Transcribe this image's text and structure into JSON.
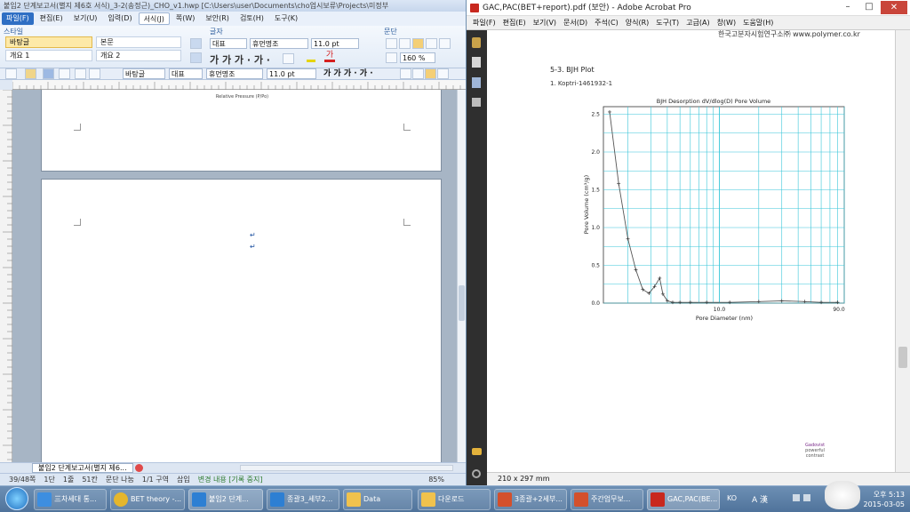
{
  "hwp": {
    "title": "붙임2 단계보고서(별지 제6호 서식)_3-2(송정근)_CHO_v1.hwp [C:\\Users\\user\\Documents\\cho업시보류\\Projects\\미정부",
    "menu": [
      "파일(F)",
      "편집(E)",
      "보기(U)",
      "입력(D)",
      "서식(J)",
      "쪽(W)",
      "보안(R)",
      "검토(H)",
      "도구(K)"
    ],
    "style_group": "스타일",
    "styles": [
      "바탕글",
      "본문",
      "개요 1",
      "개요 2"
    ],
    "font_group": "글자",
    "para_group": "문단",
    "font_lang": "대표",
    "font_name": "휴먼명조",
    "font_size": "11.0",
    "font_unit": "pt",
    "line_spacing": "160 %",
    "toolbar2": {
      "style": "바탕글",
      "lang": "대표",
      "font": "휴먼명조",
      "size": "11.0",
      "unit": "pt"
    },
    "page1_footer": "Relative Pressure (P/Po)",
    "tab_label": "붙임2 단계보고서(별지 제6...",
    "status": [
      "39/48쪽",
      "1단",
      "1줄",
      "51칸",
      "문단 나눔",
      "1/1 구역",
      "삽입",
      "변경 내용 [기록 중지]"
    ],
    "zoom": "85%"
  },
  "acrobat": {
    "title": "GAC,PAC(BET+report).pdf (보안) - Adobe Acrobat Pro",
    "menu": [
      "파일(F)",
      "편집(E)",
      "보기(V)",
      "문서(D)",
      "주석(C)",
      "양식(R)",
      "도구(T)",
      "고급(A)",
      "창(W)",
      "도움말(H)"
    ],
    "header_right": "한국고분자시험연구소㈜ www.polymer.co.kr",
    "section": "5-3. BJH Plot",
    "sample": "1. Koptri-1461932-1",
    "logo_text": [
      "Gadovist",
      "powerful",
      "contrast"
    ],
    "page_size": "210 x 297 mm"
  },
  "chart_data": {
    "type": "line",
    "title": "BJH Desorption dV/dlog(D) Pore Volume",
    "xlabel": "Pore Diameter (nm)",
    "ylabel": "Pore Volume (cm³/g)",
    "x_tick_labels": [
      "10.0",
      "90.0"
    ],
    "y_ticks": [
      0.0,
      0.5,
      1.0,
      1.5,
      2.0,
      2.5
    ],
    "y_tick_labels": [
      "0.0",
      "0.5",
      "1.0",
      "1.5",
      "2.0",
      "2.5"
    ],
    "xlim": [
      1.3,
      90
    ],
    "ylim": [
      0,
      2.6
    ],
    "x_scale": "log",
    "grid": true,
    "series": [
      {
        "x": [
          1.45,
          1.7,
          2.0,
          2.3,
          2.6,
          2.9,
          3.2,
          3.5,
          3.7,
          4.0,
          4.4,
          5.0,
          6.0,
          8.0,
          12,
          20,
          30,
          45,
          60,
          80
        ],
        "y": [
          2.53,
          1.58,
          0.85,
          0.44,
          0.18,
          0.13,
          0.22,
          0.33,
          0.12,
          0.03,
          0.01,
          0.01,
          0.01,
          0.01,
          0.01,
          0.02,
          0.03,
          0.02,
          0.01,
          0.01
        ]
      }
    ]
  },
  "taskbar": {
    "items": [
      "三차세대 통...",
      "BET theory -...",
      "붙임2 단계...",
      "종괄3_세부2...",
      "Data",
      "다운로드",
      "3종괄+2세부...",
      "주간업무보...",
      "GAC,PAC(BE..."
    ],
    "lang": "KO",
    "ime": "A 漢",
    "time": "오후 5:13",
    "date": "2015-03-05"
  },
  "colors": {
    "grid": "#38c6d9",
    "accent": "#2f6fc4",
    "curve": "#555555"
  }
}
